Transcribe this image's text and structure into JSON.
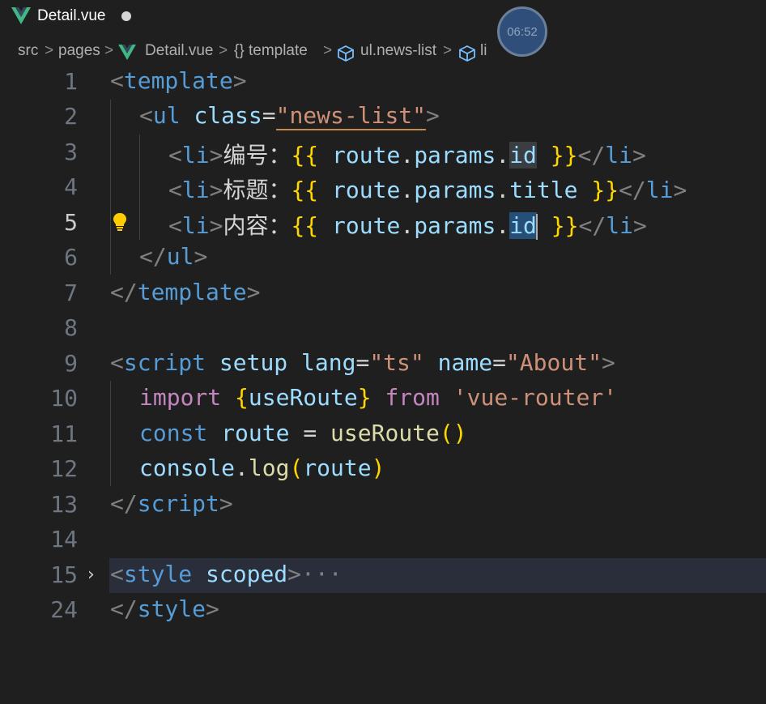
{
  "tab": {
    "title": "Detail.vue"
  },
  "timer": "06:52",
  "breadcrumb": {
    "items": [
      "src",
      "pages",
      "Detail.vue",
      "{} template",
      "ul.news-list",
      "li"
    ]
  },
  "editor": {
    "line_numbers": [
      "1",
      "2",
      "3",
      "4",
      "5",
      "6",
      "7",
      "8",
      "9",
      "10",
      "11",
      "12",
      "13",
      "14",
      "15",
      "24"
    ],
    "active_line": "5",
    "lines": {
      "l1": {
        "open": "<",
        "tag": "template",
        "close": ">"
      },
      "l2": {
        "open": "<",
        "tag": "ul",
        "attr": "class",
        "eq": "=",
        "str": "\"news-list\"",
        "close": ">"
      },
      "l3": {
        "open": "<",
        "tag": "li",
        "close": ">",
        "label": "编号：",
        "lbrace": "{{",
        "expr1": "route",
        "dot1": ".",
        "expr2": "params",
        "dot2": ".",
        "expr3": "id",
        "rbrace": "}}",
        "endopen": "</",
        "endtag": "li",
        "endclose": ">"
      },
      "l4": {
        "open": "<",
        "tag": "li",
        "close": ">",
        "label": "标题：",
        "lbrace": "{{",
        "expr1": "route",
        "dot1": ".",
        "expr2": "params",
        "dot2": ".",
        "expr3": "title",
        "rbrace": "}}",
        "endopen": "</",
        "endtag": "li",
        "endclose": ">"
      },
      "l5": {
        "open": "<",
        "tag": "li",
        "close": ">",
        "label": "内容：",
        "lbrace": "{{",
        "expr1": "route",
        "dot1": ".",
        "expr2": "params",
        "dot2": ".",
        "expr3": "id",
        "rbrace": "}}",
        "endopen": "</",
        "endtag": "li",
        "endclose": ">"
      },
      "l6": {
        "open": "</",
        "tag": "ul",
        "close": ">"
      },
      "l7": {
        "open": "</",
        "tag": "template",
        "close": ">"
      },
      "l9": {
        "open": "<",
        "tag": "script",
        "attr1": "setup",
        "attr2": "lang",
        "eq1": "=",
        "str1": "\"ts\"",
        "attr3": "name",
        "eq2": "=",
        "str2": "\"About\"",
        "close": ">"
      },
      "l10": {
        "kw": "import",
        "lb": "{",
        "id": "useRoute",
        "rb": "}",
        "kw2": "from",
        "str": "'vue-router'"
      },
      "l11": {
        "kw": "const",
        "id": "route",
        "op": "=",
        "fn": "useRoute",
        "paren": "()"
      },
      "l12": {
        "obj": "console",
        "dot": ".",
        "fn": "log",
        "lp": "(",
        "arg": "route",
        "rp": ")"
      },
      "l13": {
        "open": "</",
        "tag": "script",
        "close": ">"
      },
      "l15": {
        "open": "<",
        "tag": "style",
        "attr": "scoped",
        "close": ">",
        "ellipsis": "···"
      },
      "l24": {
        "open": "</",
        "tag": "style",
        "close": ">"
      }
    }
  },
  "colors": {
    "background": "#1f1f1f",
    "tag": "#569cd6",
    "attribute": "#9cdcfe",
    "string": "#ce9178",
    "brace": "#ffd700",
    "keyword": "#c586c0",
    "function": "#dcdcaa"
  },
  "icons": [
    "vue-icon",
    "dirty-dot-icon",
    "chevron-right-icon",
    "lightbulb-icon",
    "symbol-icon"
  ]
}
